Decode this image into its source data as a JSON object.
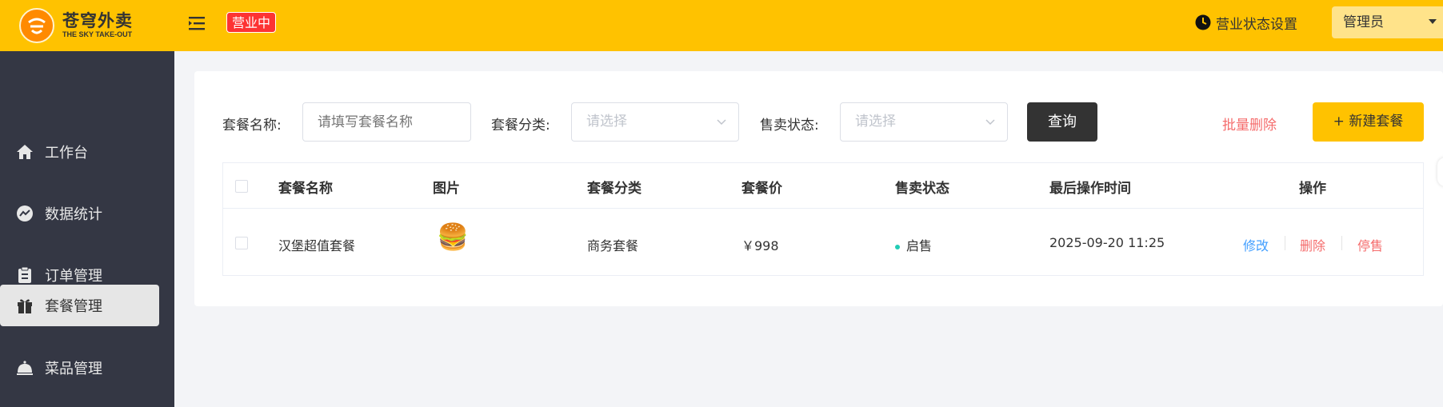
{
  "header": {
    "logo_title": "苍穹外卖",
    "logo_subtitle": "THE SKY TAKE-OUT",
    "status_badge": "营业中",
    "business_settings": "营业状态设置",
    "admin": "管理员"
  },
  "sidebar": {
    "items": [
      {
        "label": "工作台",
        "icon": "home-icon",
        "active": false
      },
      {
        "label": "数据统计",
        "icon": "chart-icon",
        "active": false
      },
      {
        "label": "订单管理",
        "icon": "clipboard-icon",
        "active": false
      },
      {
        "label": "套餐管理",
        "icon": "gift-icon",
        "active": true
      },
      {
        "label": "菜品管理",
        "icon": "cloche-icon",
        "active": false
      }
    ]
  },
  "filters": {
    "name_label": "套餐名称:",
    "name_placeholder": "请填写套餐名称",
    "category_label": "套餐分类:",
    "category_placeholder": "请选择",
    "status_label": "售卖状态:",
    "status_placeholder": "请选择",
    "query_button": "查询",
    "batch_delete": "批量删除",
    "new_button": "+ 新建套餐"
  },
  "table": {
    "columns": [
      "套餐名称",
      "图片",
      "套餐分类",
      "套餐价",
      "售卖状态",
      "最后操作时间",
      "操作"
    ],
    "rows": [
      {
        "name": "汉堡超值套餐",
        "image": "🍔",
        "category": "商务套餐",
        "price": "￥998",
        "status": "启售",
        "updated": "2025-09-20 11:25",
        "actions": {
          "edit": "修改",
          "delete": "删除",
          "toggle": "停售"
        }
      }
    ]
  },
  "colors": {
    "brand_yellow": "#ffc200",
    "sidebar_bg": "#343744",
    "danger": "#f56c6c",
    "link_blue": "#419eff",
    "status_green": "#22ccb5"
  }
}
